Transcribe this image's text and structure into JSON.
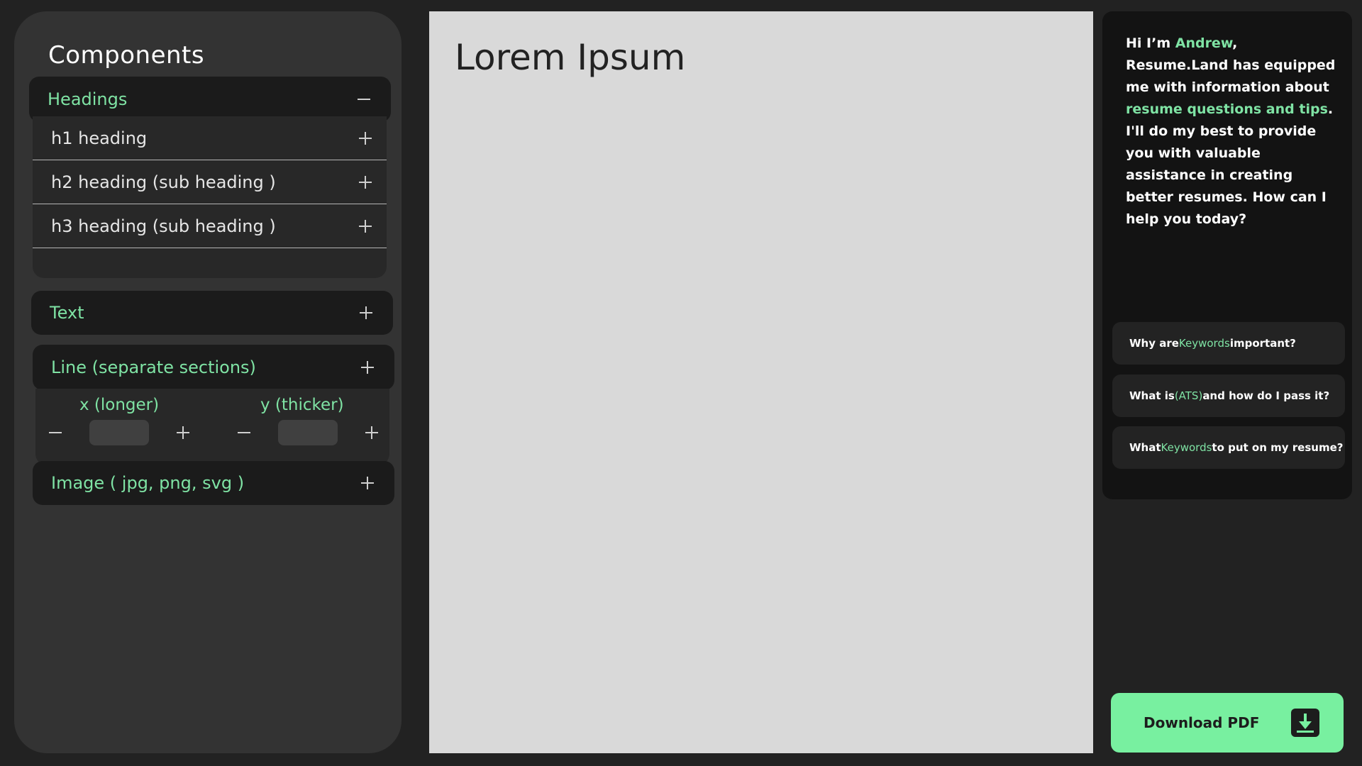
{
  "sidebar": {
    "title": "Components",
    "headings": {
      "label": "Headings",
      "items": [
        {
          "label": "h1 heading"
        },
        {
          "label": "h2 heading (sub heading )"
        },
        {
          "label": "h3 heading (sub heading )"
        }
      ]
    },
    "text": {
      "label": "Text"
    },
    "line": {
      "label": "Line (separate sections)",
      "x_label": "x (longer)",
      "y_label": "y (thicker)",
      "x_value": "",
      "y_value": ""
    },
    "image": {
      "label": "Image ( jpg, png, svg )"
    }
  },
  "canvas": {
    "title": "Lorem Ipsum"
  },
  "assistant": {
    "message": {
      "p1": "Hi I’m ",
      "name": "Andrew",
      "p2": ", Resume.Land has equipped me with information about ",
      "topic": "resume questions and tips",
      "p3": ". I'll do my best to provide you with valuable assistance in creating better resumes. How can I help you today?"
    },
    "suggestions": [
      {
        "pre": "Why are ",
        "kw": "Keywords",
        "post": " important?"
      },
      {
        "pre": "What is ",
        "kw": "(ATS)",
        "post": " and how do I pass it?"
      },
      {
        "pre": "What ",
        "kw": "Keywords",
        "post": " to put on my resume?"
      }
    ]
  },
  "download": {
    "label": "Download PDF",
    "icon": "download-icon"
  },
  "colors": {
    "accent": "#7fe3a4",
    "button": "#78f0a0",
    "background": "#222222",
    "canvas": "#d9d9d9"
  }
}
